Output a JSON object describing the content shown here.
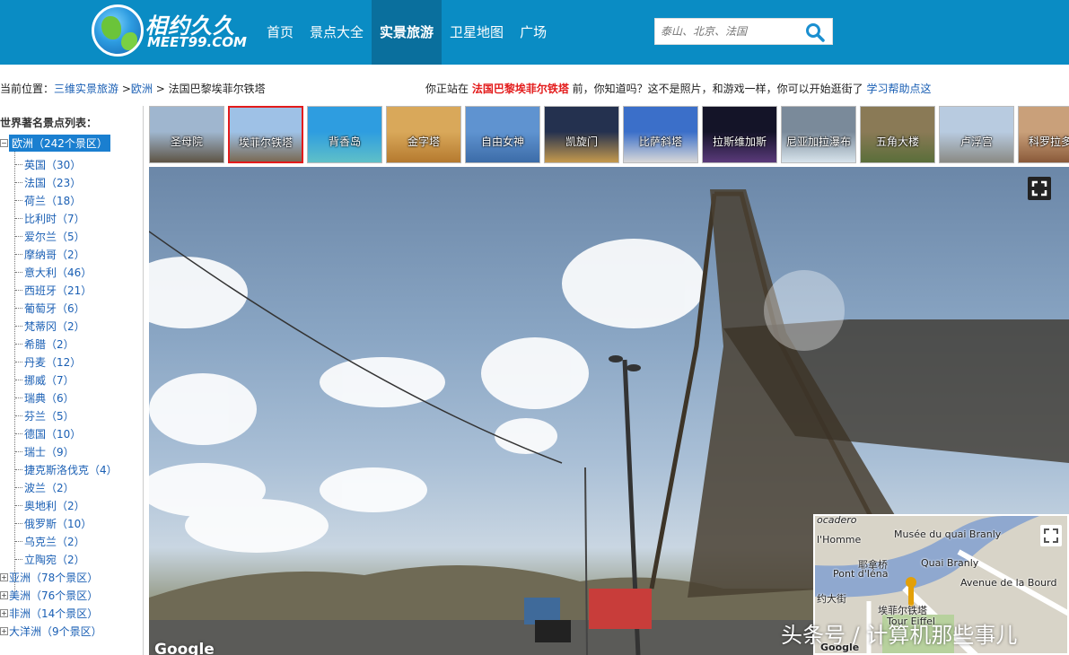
{
  "header": {
    "logo_title": "相约久久",
    "logo_sub": "MEET99.COM",
    "nav": [
      "首页",
      "景点大全",
      "实景旅游",
      "卫星地图",
      "广场"
    ],
    "active_nav": "实景旅游",
    "search_placeholder": "泰山、北京、法国",
    "search_icon": "search-icon"
  },
  "breadcrumb": {
    "prefix": "当前位置：",
    "link1": "三维实景旅游",
    "sep1": " >",
    "link2": "欧洲",
    "sep2": " > ",
    "current": "法国巴黎埃菲尔铁塔"
  },
  "notice": {
    "pre": "你正站在 ",
    "highlight": "法国巴黎埃菲尔铁塔",
    "post": " 前，你知道吗？这不是照片，和游戏一样，你可以开始逛街了 ",
    "link": "学习帮助点这"
  },
  "sidebar": {
    "title": "世界著名景点列表：",
    "root": "欧洲（242个景区）",
    "countries": [
      "英国（30）",
      "法国（23）",
      "荷兰（18）",
      "比利时（7）",
      "爱尔兰（5）",
      "摩纳哥（2）",
      "意大利（46）",
      "西班牙（21）",
      "葡萄牙（6）",
      "梵蒂冈（2）",
      "希腊（2）",
      "丹麦（12）",
      "挪威（7）",
      "瑞典（6）",
      "芬兰（5）",
      "德国（10）",
      "瑞士（9）",
      "捷克斯洛伐克（4）",
      "波兰（2）",
      "奥地利（2）",
      "俄罗斯（10）",
      "乌克兰（2）",
      "立陶宛（2）"
    ],
    "continents": [
      "亚洲（78个景区）",
      "美洲（76个景区）",
      "非洲（14个景区）",
      "大洋洲（9个景区）"
    ]
  },
  "thumbnails": [
    "圣母院",
    "埃菲尔铁塔",
    "背香岛",
    "金字塔",
    "自由女神",
    "凯旋门",
    "比萨斜塔",
    "拉斯维加斯",
    "尼亚加拉瀑布",
    "五角大楼",
    "卢浮宫",
    "科罗拉多大"
  ],
  "active_thumbnail": "埃菲尔铁塔",
  "viewer": {
    "google_mark": "Google",
    "fullscreen_icon": "fullscreen-icon"
  },
  "minimap": {
    "labels": [
      "ocadero",
      "l'Homme",
      "Musée du quai Branly",
      "耶拿桥",
      "Pont d'Iéna",
      "约大街",
      "埃菲尔铁塔",
      "Tour Eiffel",
      "Avenue de la Bourd",
      "Quai Branly",
      "Google"
    ]
  },
  "watermark": "头条号 / 计算机那些事儿",
  "colors": {
    "header_bg": "#0a8cc4",
    "nav_active_bg": "#0a6f9d",
    "link": "#1a5fb4",
    "highlight": "#e31b1b",
    "tree_selected": "#1a7fd0"
  }
}
